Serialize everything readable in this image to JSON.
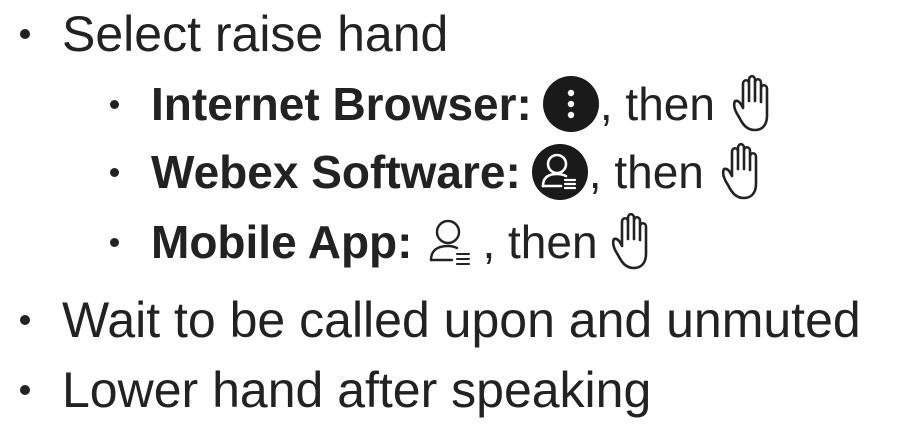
{
  "bullets": {
    "raise": "Select raise hand",
    "browser": {
      "label": "Internet Browser:",
      "then": ", then"
    },
    "software": {
      "label": "Webex Software:",
      "then": ", then"
    },
    "mobile": {
      "label": "Mobile App:",
      "then": ", then"
    },
    "wait": "Wait to be called upon and unmuted",
    "lower": "Lower hand after speaking"
  },
  "icons": {
    "browser_menu": "more-options-icon",
    "software_participants": "participants-icon",
    "mobile_participants": "participants-icon",
    "hand": "raise-hand-icon"
  },
  "colors": {
    "text": "#222222",
    "icon_dark": "#1a1a1a"
  }
}
